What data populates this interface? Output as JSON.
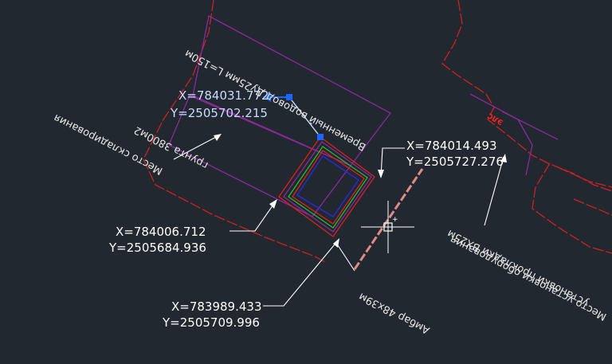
{
  "coordinate_labels": [
    {
      "x": "X=784031.772",
      "y": "Y=2505702.215",
      "selected": true
    },
    {
      "x": "X=784014.493",
      "y": "Y=2505727.276",
      "selected": false
    },
    {
      "x": "X=784006.712",
      "y": "Y=2505684.936",
      "selected": false
    },
    {
      "x": "X=783989.433",
      "y": "Y=2505709.996",
      "selected": false
    }
  ],
  "annotations": {
    "temp_water": "Временный водовод Ду25мм L=150м",
    "soil_storage_line1": "Место складирования",
    "soil_storage_line2": "грунта 3800м2",
    "equipment_line1": "Место установки оборудования",
    "equipment_line2": "установки прокладки ВХ25м",
    "barn": "Амбар 48х39м",
    "red_tag": "ЭЛС"
  },
  "colors": {
    "background": "#212830",
    "boundary_red": "#cc2222",
    "outline_purple": "#8a2a9a",
    "inner_green": "#22c022",
    "inner_blue": "#2a2ad0",
    "inner_red": "#dd2020",
    "grip_blue": "#1a66ff",
    "selection_line": "#c9dcff",
    "pipe": "#e08a8a"
  },
  "cursor": {
    "type": "crosshair-with-pickbox"
  }
}
